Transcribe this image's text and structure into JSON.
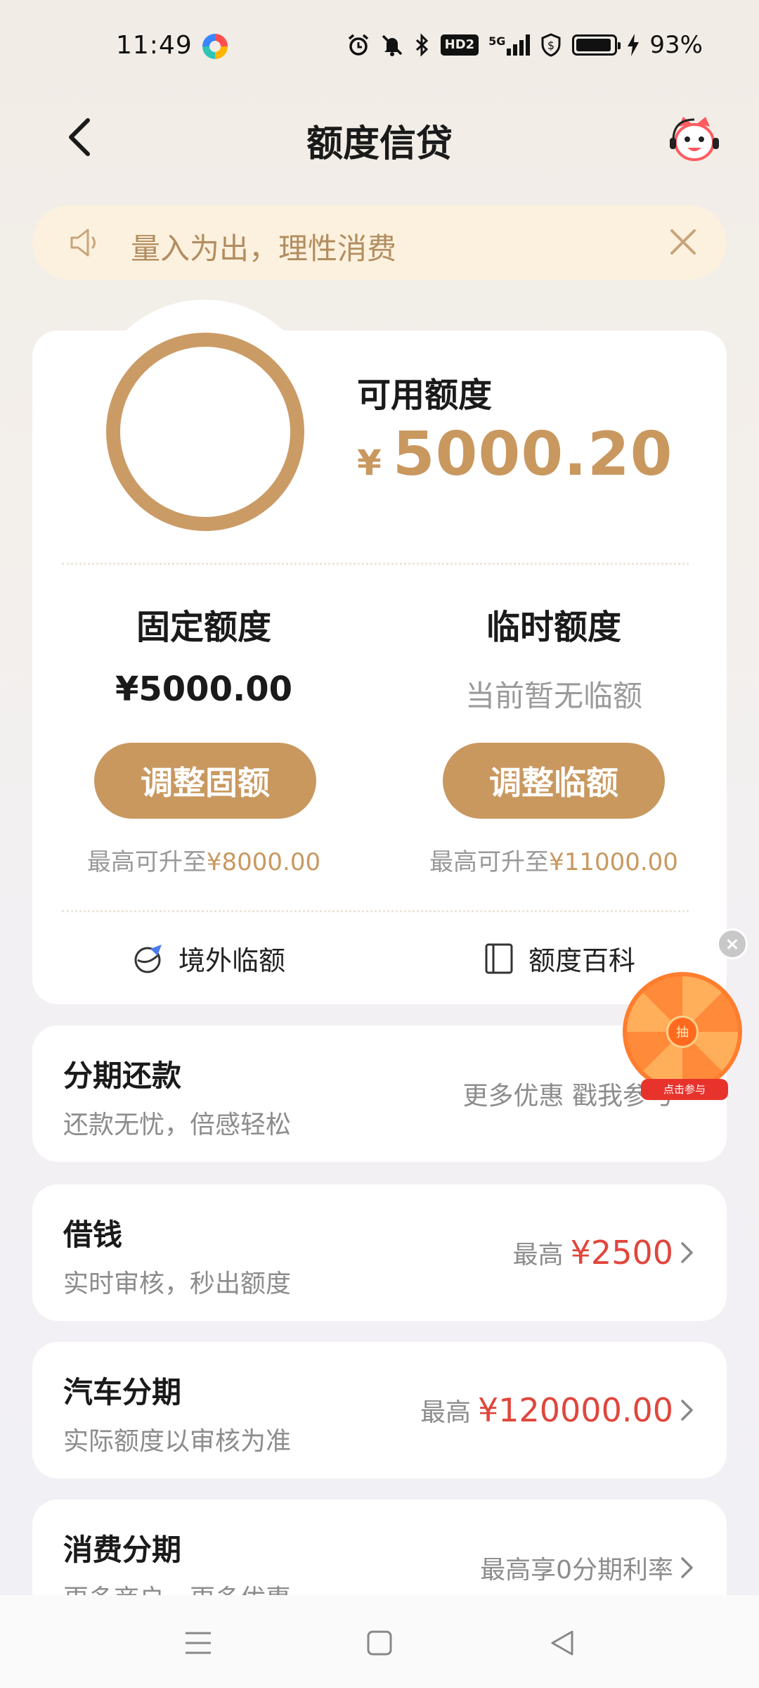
{
  "status_bar": {
    "time": "11:49",
    "battery": "93%",
    "network": "5G",
    "hd": "HD2"
  },
  "header": {
    "title": "额度信贷"
  },
  "notice": {
    "text": "量入为出，理性消费"
  },
  "credit": {
    "available_label": "可用额度",
    "currency": "¥",
    "available_amount": "5000.20",
    "fixed": {
      "title": "固定额度",
      "value": "¥5000.00",
      "button": "调整固额",
      "max_prefix": "最高可升至",
      "max_value": "¥8000.00"
    },
    "temporary": {
      "title": "临时额度",
      "value": "当前暂无临额",
      "button": "调整临额",
      "max_prefix": "最高可升至",
      "max_value": "¥11000.00"
    },
    "links": {
      "overseas": "境外临额",
      "encyclopedia": "额度百科"
    }
  },
  "floating": {
    "wheel_center": "抽",
    "wheel_ribbon": "点击参与"
  },
  "services": [
    {
      "title": "分期还款",
      "subtitle": "还款无忧，倍感轻松",
      "right_text": "更多优惠 戳我参与",
      "prefix": "",
      "amount": ""
    },
    {
      "title": "借钱",
      "subtitle": "实时审核，秒出额度",
      "right_text": "",
      "prefix": "最高",
      "amount": "¥2500"
    },
    {
      "title": "汽车分期",
      "subtitle": "实际额度以审核为准",
      "right_text": "",
      "prefix": "最高",
      "amount": "¥120000.00"
    },
    {
      "title": "消费分期",
      "subtitle": "更多商户，更多优惠",
      "right_text": "最高享0分期利率",
      "prefix": "",
      "amount": ""
    }
  ],
  "colors": {
    "accent": "#c9985f",
    "notice_bg": "#fbf1de",
    "notice_text": "#b38d60",
    "amount_red": "#e0463c"
  }
}
